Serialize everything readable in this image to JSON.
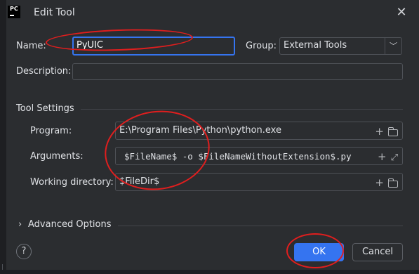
{
  "window": {
    "title": "Edit Tool",
    "app_icon_text": "PC"
  },
  "name": {
    "label": "Name:",
    "value": "PyUIC"
  },
  "group": {
    "label": "Group:",
    "value": "External Tools"
  },
  "description": {
    "label": "Description:",
    "value": ""
  },
  "tool_settings": {
    "title": "Tool Settings",
    "program": {
      "label": "Program:",
      "value": "E:\\Program Files\\Python\\python.exe"
    },
    "arguments": {
      "label": "Arguments:",
      "value": "$FileName$ -o $FileNameWithoutExtension$.py"
    },
    "working_directory": {
      "label": "Working directory:",
      "value": "$FileDir$"
    }
  },
  "advanced": {
    "label": "Advanced Options"
  },
  "footer": {
    "help": "?",
    "ok": "OK",
    "cancel": "Cancel"
  },
  "annotation_color": "#e01e1e",
  "accent_color": "#3574f0"
}
